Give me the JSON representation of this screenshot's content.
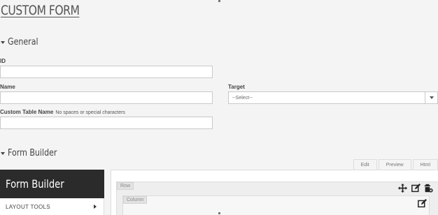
{
  "page": {
    "title": "CUSTOM FORM"
  },
  "general": {
    "header": "General",
    "id_label": "ID",
    "id_value": "",
    "name_label": "Name",
    "name_value": "",
    "target_label": "Target",
    "target_selected": "--Select--",
    "table_name_label": "Custom Table Name",
    "table_name_hint": "No spaces or special characters",
    "table_name_value": ""
  },
  "form_builder": {
    "header": "Form Builder",
    "panel_title": "Form Builder",
    "layout_tools_label": "LAYOUT TOOLS",
    "tabs": [
      "Edit",
      "Preview",
      "Html"
    ],
    "row_label": "Row",
    "column_label": "Column"
  },
  "icons": {
    "move": "move-icon",
    "edit": "edit-icon",
    "delete": "trash-icon",
    "section_toggle": "caret-down-icon",
    "expand": "chevron-right-icon"
  }
}
